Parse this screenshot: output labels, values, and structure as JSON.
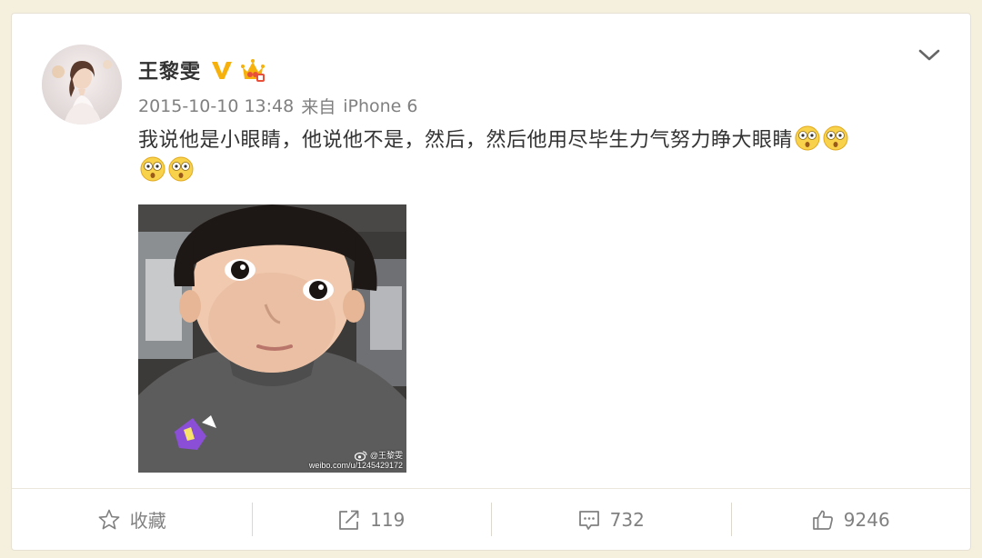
{
  "author": {
    "name": "王黎雯",
    "verified_icon": "verified-v-badge",
    "vip_icon": "vip-crown-icon"
  },
  "meta": {
    "timestamp": "2015-10-10 13:48",
    "source_prefix": "来自",
    "source_device": "iPhone 6"
  },
  "post": {
    "text": "我说他是小眼睛，他说他不是，然后，然后他用尽毕生力气努力睁大眼睛",
    "emoji_icon": "shocked-face-emoji",
    "emoji_count": 4
  },
  "photo": {
    "watermark_handle": "@王黎雯",
    "watermark_url": "weibo.com/u/1245429172"
  },
  "actions": {
    "favorite_label": "收藏",
    "repost_count": "119",
    "comment_count": "732",
    "like_count": "9246"
  },
  "colors": {
    "background": "#f5efdd",
    "card": "#ffffff",
    "meta_text": "#808080",
    "verified_gold": "#f6b10c"
  }
}
